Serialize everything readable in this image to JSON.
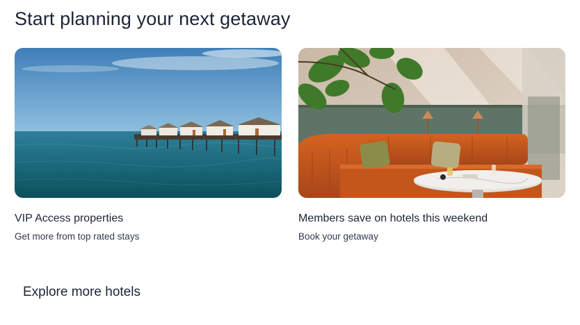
{
  "heading": "Start planning your next getaway",
  "cards": [
    {
      "title": "VIP Access properties",
      "subtitle": "Get more from top rated stays",
      "image_alt": "Overwater villas on a pier above the sea"
    },
    {
      "title": "Members save on hotels this weekend",
      "subtitle": "Book your getaway",
      "image_alt": "Hotel lounge with orange velvet sofa and marble table"
    }
  ],
  "explore_link": "Explore more hotels"
}
